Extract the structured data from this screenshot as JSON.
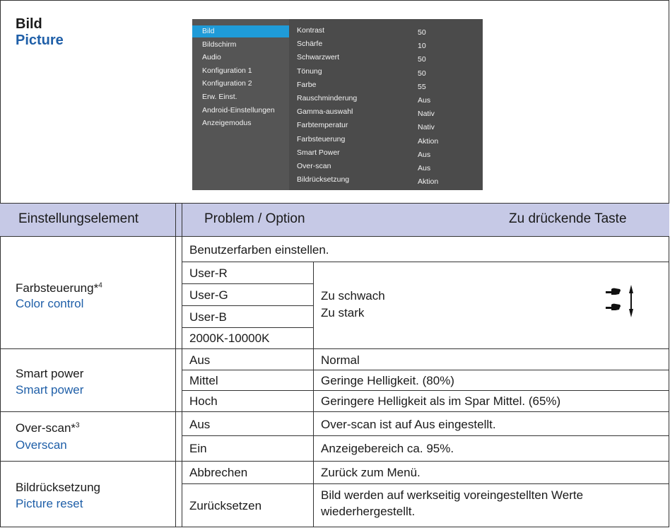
{
  "title": {
    "de": "Bild",
    "en": "Picture"
  },
  "osd": {
    "menu": [
      "Bild",
      "Bildschirm",
      "Audio",
      "Konfiguration 1",
      "Konfiguration 2",
      "Erw. Einst.",
      "Android-Einstellungen",
      "Anzeigemodus"
    ],
    "selected_index": 0,
    "settings": [
      {
        "label": "Kontrast",
        "value": "50"
      },
      {
        "label": "Schärfe",
        "value": "10"
      },
      {
        "label": "Schwarzwert",
        "value": "50"
      },
      {
        "label": "Tönung",
        "value": "50"
      },
      {
        "label": "Farbe",
        "value": "55"
      },
      {
        "label": "Rauschminderung",
        "value": "Aus"
      },
      {
        "label": "Gamma-auswahl",
        "value": "Nativ"
      },
      {
        "label": "Farbtemperatur",
        "value": "Nativ"
      },
      {
        "label": "Farbsteuerung",
        "value": "Aktion"
      },
      {
        "label": "Smart Power",
        "value": "Aus"
      },
      {
        "label": "Over-scan",
        "value": "Aus"
      },
      {
        "label": "Bildrücksetzung",
        "value": "Aktion"
      }
    ],
    "colors": {
      "bg": "#4b4b4b",
      "sidebar": "#555555",
      "highlight": "#1f9bd8"
    }
  },
  "table": {
    "headers": {
      "element": "Einstellungselement",
      "problem": "Problem / Option",
      "key": "Zu drückende Taste"
    },
    "header_bg": "#c6c9e6",
    "color_control": {
      "name_de": "Farbsteuerung*",
      "sup": "4",
      "name_en": "Color control",
      "intro": "Benutzerfarben einstellen.",
      "options": [
        "User-R",
        "User-G",
        "User-B",
        "2000K-10000K"
      ],
      "weak": "Zu schwach",
      "strong": "Zu stark"
    },
    "smart_power": {
      "name_de": "Smart power",
      "name_en": "Smart power",
      "rows": [
        {
          "option": "Aus",
          "desc": "Normal"
        },
        {
          "option": "Mittel",
          "desc": "Geringe Helligkeit. (80%)"
        },
        {
          "option": "Hoch",
          "desc": "Geringere Helligkeit als im Spar Mittel. (65%)"
        }
      ]
    },
    "over_scan": {
      "name_de": "Over-scan*",
      "sup": "3",
      "name_en": "Overscan",
      "rows": [
        {
          "option": "Aus",
          "desc": "Over-scan ist auf Aus eingestellt."
        },
        {
          "option": "Ein",
          "desc": "Anzeigebereich ca. 95%."
        }
      ]
    },
    "picture_reset": {
      "name_de": "Bildrücksetzung",
      "name_en": "Picture reset",
      "rows": [
        {
          "option": "Abbrechen",
          "desc": "Zurück zum Menü."
        },
        {
          "option": "Zurücksetzen",
          "desc_line1": "Bild werden auf  werkseitig voreingestellten Werte",
          "desc_line2": "wiederhergestellt."
        }
      ]
    }
  }
}
